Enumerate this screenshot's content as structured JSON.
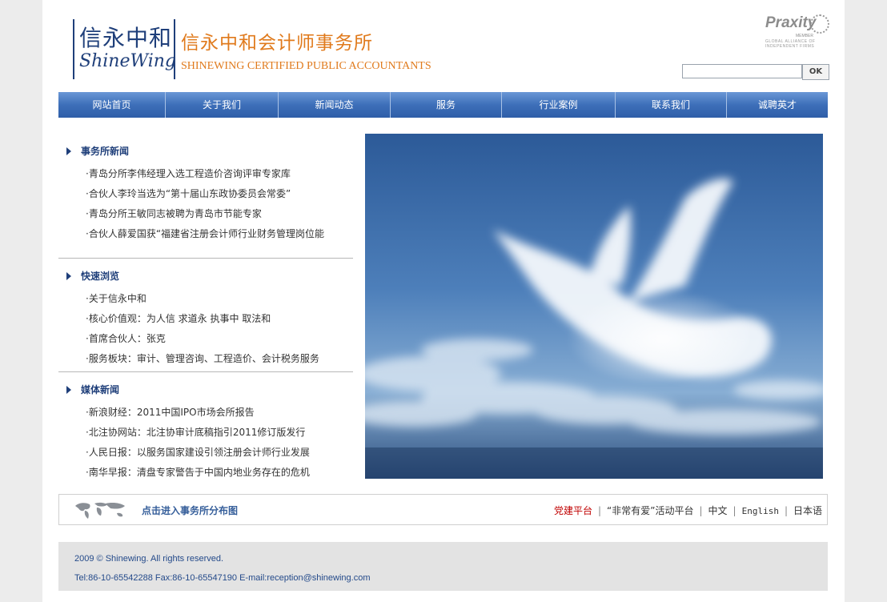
{
  "header": {
    "logo_cn": "信永中和",
    "logo_en": "ShineWing",
    "firm_name_cn": "信永中和会计师事务所",
    "firm_name_en": "SHINEWING CERTIFIED PUBLIC ACCOUNTANTS",
    "praxity": {
      "name": "Praxity",
      "member": "MEMBER",
      "tagline_1": "GLOBAL ALLIANCE OF",
      "tagline_2": "INDEPENDENT FIRMS"
    },
    "search": {
      "value": "",
      "placeholder": "",
      "button_label": "OK"
    }
  },
  "nav": {
    "items": [
      {
        "label": "网站首页"
      },
      {
        "label": "关于我们"
      },
      {
        "label": "新闻动态"
      },
      {
        "label": "服务"
      },
      {
        "label": "行业案例"
      },
      {
        "label": "联系我们"
      },
      {
        "label": "诚聘英才"
      }
    ]
  },
  "sections": {
    "news": {
      "title": "事务所新闻",
      "items": [
        "·青岛分所李伟经理入选工程造价咨询评审专家库",
        "·合伙人李玲当选为“第十届山东政协委员会常委”",
        "·青岛分所王敏同志被聘为青岛市节能专家",
        "·合伙人薛爱国获“福建省注册会计师行业财务管理岗位能"
      ]
    },
    "quick": {
      "title": "快速浏览",
      "items": [
        "·关于信永中和",
        "·核心价值观：为人信 求道永 执事中 取法和",
        "·首席合伙人：张克",
        "·服务板块：审计、管理咨询、工程造价、会计税务服务"
      ]
    },
    "media": {
      "title": "媒体新闻",
      "items": [
        "·新浪财经：2011中国IPO市场会所报告",
        "·北注协网站：北注协审计底稿指引2011修订版发行",
        "·人民日报：以服务国家建设引领注册会计师行业发展",
        "·南华早报：清盘专家警告于中国内地业务存在的危机"
      ]
    }
  },
  "bottom_bar": {
    "map_link": "点击进入事务所分布图",
    "links": {
      "party": "党建平台",
      "activity": "“非常有爱”活动平台",
      "chinese": "中文",
      "english": "English",
      "japanese": "日本语"
    }
  },
  "footer": {
    "copyright": "2009 © Shinewing. All rights reserved.",
    "contact": "Tel:86-10-65542288 Fax:86-10-65547190 E-mail:reception@shinewing.com"
  },
  "colors": {
    "brand_blue": "#1f3f7a",
    "brand_orange": "#e07a1c",
    "nav_blue": "#3d6fb9",
    "party_red": "#c00000"
  }
}
